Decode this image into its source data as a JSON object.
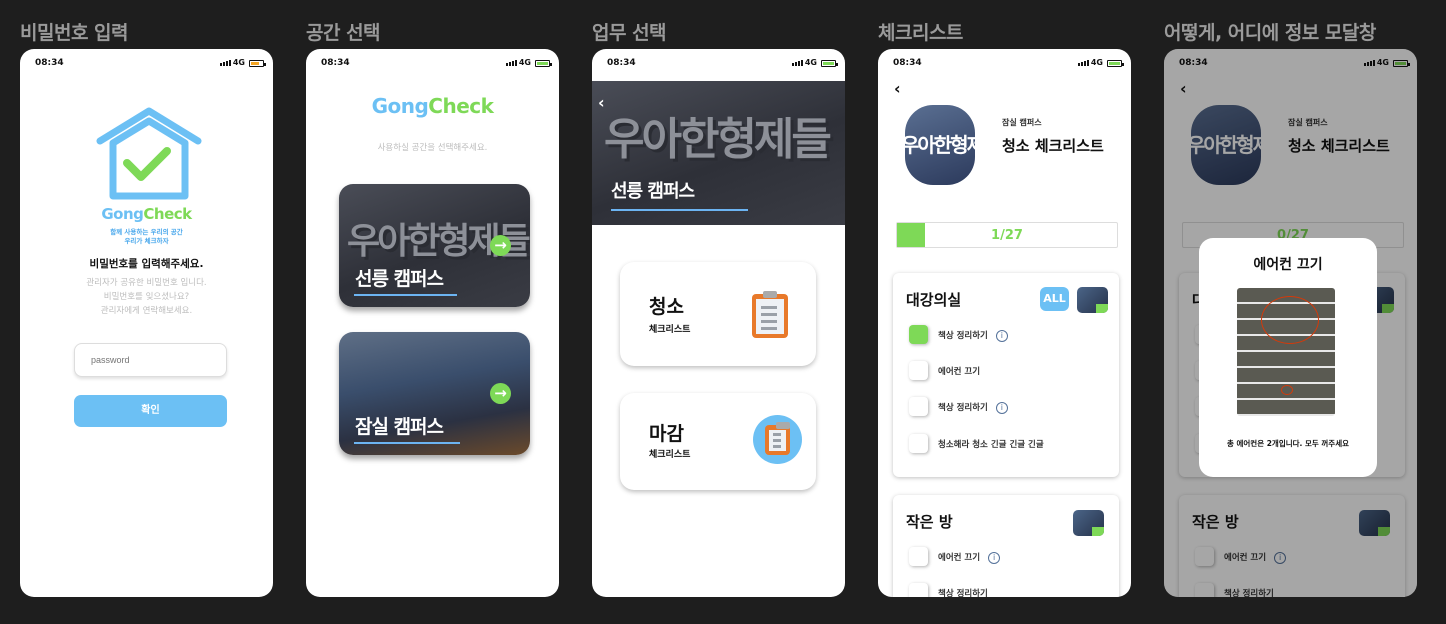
{
  "screen_titles": [
    "비밀번호 입력",
    "공간 선택",
    "업무 선택",
    "체크리스트",
    "어떻게, 어디에 정보 모달창"
  ],
  "status": {
    "time": "08:34",
    "network": "4G"
  },
  "colors": {
    "blue": "#6cc0f4",
    "green": "#7ed957",
    "battery_low": "#f5a623",
    "background": "#1e1e1e"
  },
  "logo": {
    "part1": "Gong",
    "part2": "Check",
    "tagline1": "함께 사용하는 우리의 공간",
    "tagline2": "우리가 체크하자",
    "icon": "house-check-icon"
  },
  "password": {
    "heading": "비밀번호를 입력해주세요.",
    "desc1": "관리자가 공유한 비밀번호 입니다.",
    "desc2": "비밀번호를 잊으셨나요?",
    "desc3": "관리자에게 연락해보세요.",
    "placeholder": "password",
    "confirm": "확인"
  },
  "space": {
    "subtitle": "사용하실 공간을 선택해주세요.",
    "sign": "우아한형제들",
    "campuses": [
      "선릉 캠퍼스",
      "잠실 캠퍼스"
    ]
  },
  "task": {
    "campus": "선릉 캠퍼스",
    "sign": "우아한형제들",
    "items": [
      {
        "title": "청소",
        "sub": "체크리스트",
        "icon": "clipboard-icon"
      },
      {
        "title": "마감",
        "sub": "체크리스트",
        "icon": "clipboard-icon"
      }
    ]
  },
  "checklist": {
    "campus": "잠실 캠퍼스",
    "title": "청소 체크리스트",
    "sign": "우아한형제들",
    "progress": {
      "done": 1,
      "total": 27,
      "label": "1/27"
    },
    "all_label": "ALL",
    "rooms": [
      {
        "name": "대강의실",
        "items": [
          {
            "label": "책상 정리하기",
            "checked": true,
            "info": true
          },
          {
            "label": "에어컨 끄기",
            "checked": false,
            "info": false
          },
          {
            "label": "책상 정리하기",
            "checked": false,
            "info": true
          },
          {
            "label": "청소해라 청소 긴글 긴글 긴글",
            "checked": false,
            "info": false
          }
        ]
      },
      {
        "name": "작은 방",
        "items": [
          {
            "label": "에어컨 끄기",
            "checked": false,
            "info": true
          },
          {
            "label": "책상 정리하기",
            "checked": false,
            "info": false
          }
        ]
      }
    ]
  },
  "modal_screen": {
    "progress_label": "0/27",
    "progress_done": 0
  },
  "modal": {
    "title": "에어컨 끄기",
    "message": "총 에어컨은 2개입니다. 모두 꺼주세요"
  }
}
